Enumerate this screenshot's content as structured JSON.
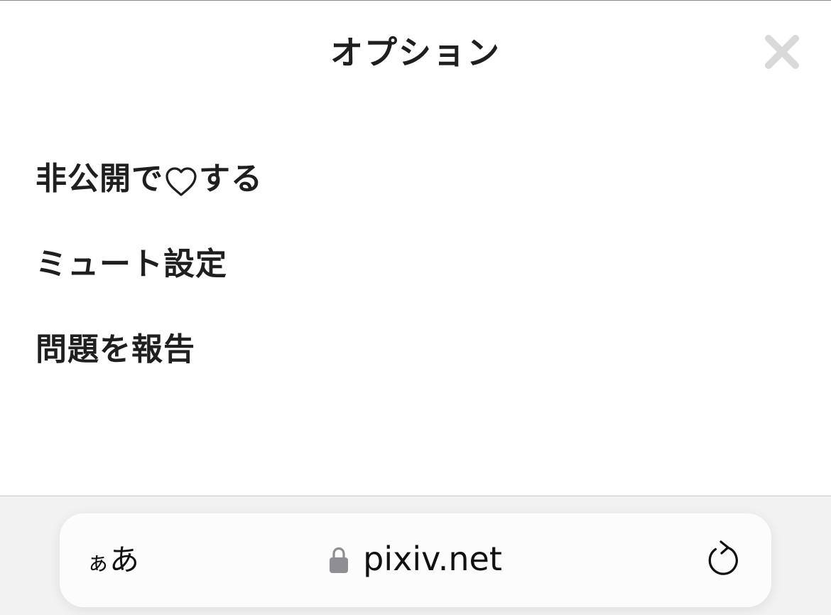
{
  "sheet": {
    "title": "オプション",
    "close_icon": "close-icon"
  },
  "menu": {
    "items": [
      {
        "prefix": "非公開で",
        "icon": "heart-outline-icon",
        "suffix": "する"
      },
      {
        "label": "ミュート設定"
      },
      {
        "label": "問題を報告"
      }
    ]
  },
  "browser": {
    "text_size_label_small": "ぁ",
    "text_size_label_large": "あ",
    "lock_icon": "lock-icon",
    "url": "pixiv.net",
    "reload_icon": "reload-icon"
  },
  "colors": {
    "text": "#1f1f1f",
    "close_icon": "#d9d9d9",
    "lock_icon": "#8e8e93",
    "toolbar_bg": "#f2f2f2"
  }
}
